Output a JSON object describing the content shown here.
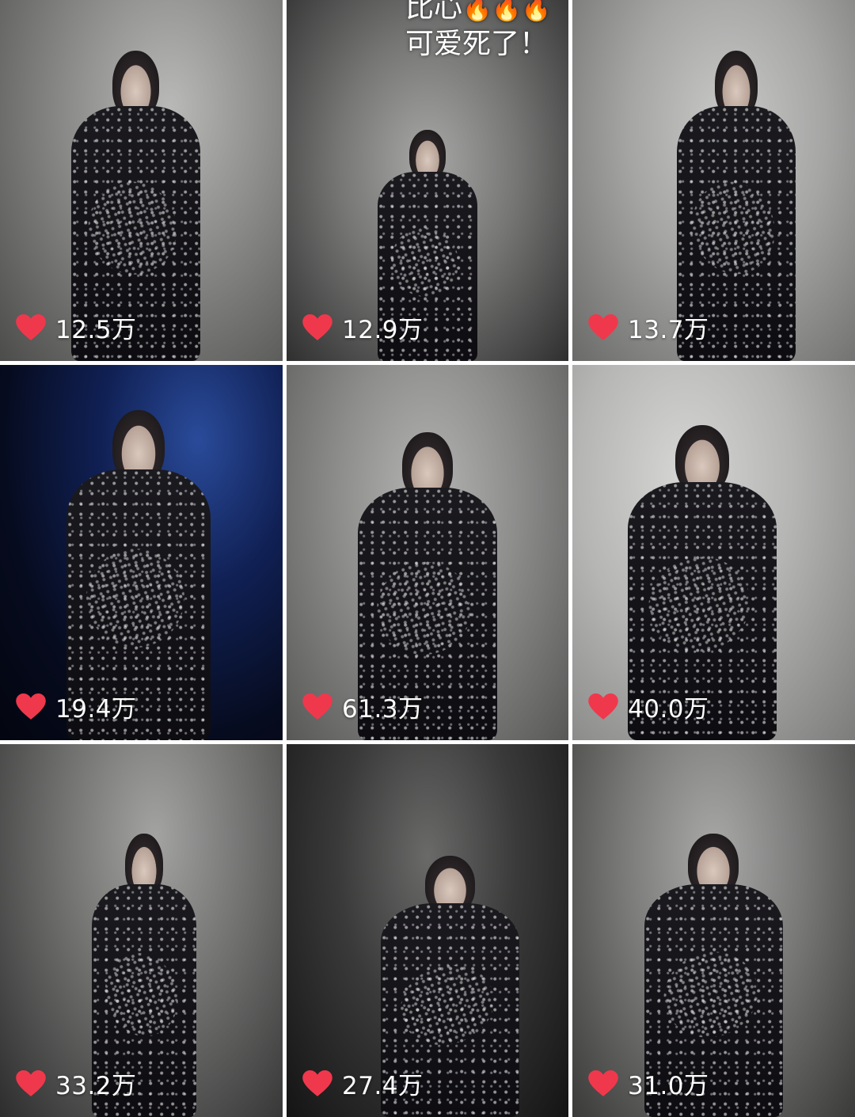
{
  "grid": {
    "tiles": [
      {
        "likes": "12.5万",
        "scene": "smoke-grey",
        "caption": null
      },
      {
        "likes": "12.9万",
        "scene": "smoke-grey-dark",
        "caption": {
          "line1": "比心",
          "emoji": "🔥🔥🔥",
          "line2": "可爱死了！"
        }
      },
      {
        "likes": "13.7万",
        "scene": "smoke-light"
      },
      {
        "likes": "19.4万",
        "scene": "stage-blue"
      },
      {
        "likes": "61.3万",
        "scene": "smoke-grey"
      },
      {
        "likes": "40.0万",
        "scene": "smoke-light"
      },
      {
        "likes": "33.2万",
        "scene": "smoke-grey"
      },
      {
        "likes": "27.4万",
        "scene": "smoke-dark"
      },
      {
        "likes": "31.0万",
        "scene": "smoke-grey"
      }
    ]
  },
  "colors": {
    "heart": "#f0384c",
    "count_text": "#ffffff",
    "gap": "#ffffff"
  },
  "icons": {
    "like": "heart-icon"
  }
}
